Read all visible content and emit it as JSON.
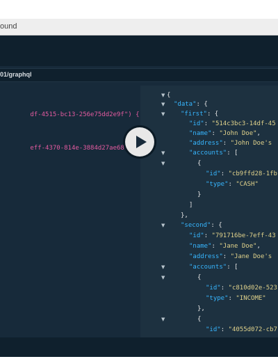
{
  "window": {
    "tab_title": "ound"
  },
  "url_bar": {
    "url": "01/graphql"
  },
  "query_editor": {
    "lines": [
      "df-4515-bc13-256e75dd2e9f\") {",
      "eff-4370-814e-3884d27ae682\") {"
    ]
  },
  "result": {
    "l1": "{",
    "l2_key": "\"data\"",
    "l2_rest": ": {",
    "l3_key": "\"first\"",
    "l3_rest": ": {",
    "l4_key": "\"id\"",
    "l4_val": "\"514c3bc3-14df-45",
    "l5_key": "\"name\"",
    "l5_val": "\"John Doe\"",
    "l6_key": "\"address\"",
    "l6_val": "\"John Doe's",
    "l7_key": "\"accounts\"",
    "l7_rest": ": [",
    "l8": "{",
    "l9_key": "\"id\"",
    "l9_val": "\"cb9ffd28-1fb",
    "l10_key": "\"type\"",
    "l10_val": "\"CASH\"",
    "l11": "}",
    "l12": "]",
    "l13": "},",
    "l14_key": "\"second\"",
    "l14_rest": ": {",
    "l15_key": "\"id\"",
    "l15_val": "\"791716be-7eff-43",
    "l16_key": "\"name\"",
    "l16_val": "\"Jane Doe\"",
    "l17_key": "\"address\"",
    "l17_val": "\"Jane Doe's",
    "l18_key": "\"accounts\"",
    "l18_rest": ": [",
    "l19": "{",
    "l20_key": "\"id\"",
    "l20_val": "\"c810d02e-523",
    "l21_key": "\"type\"",
    "l21_val": "\"INCOME\"",
    "l22": "},",
    "l23": "{",
    "l24_key": "\"id\"",
    "l24_val": "\"4055d072-cb7"
  },
  "colors": {
    "background": "#172a3a",
    "result_background": "#1d3140",
    "key": "#37b6ff",
    "string_value": "#e0d28b",
    "query_string": "#e45ba0"
  },
  "icons": {
    "run": "play-icon",
    "fold": "triangle-down-icon"
  }
}
